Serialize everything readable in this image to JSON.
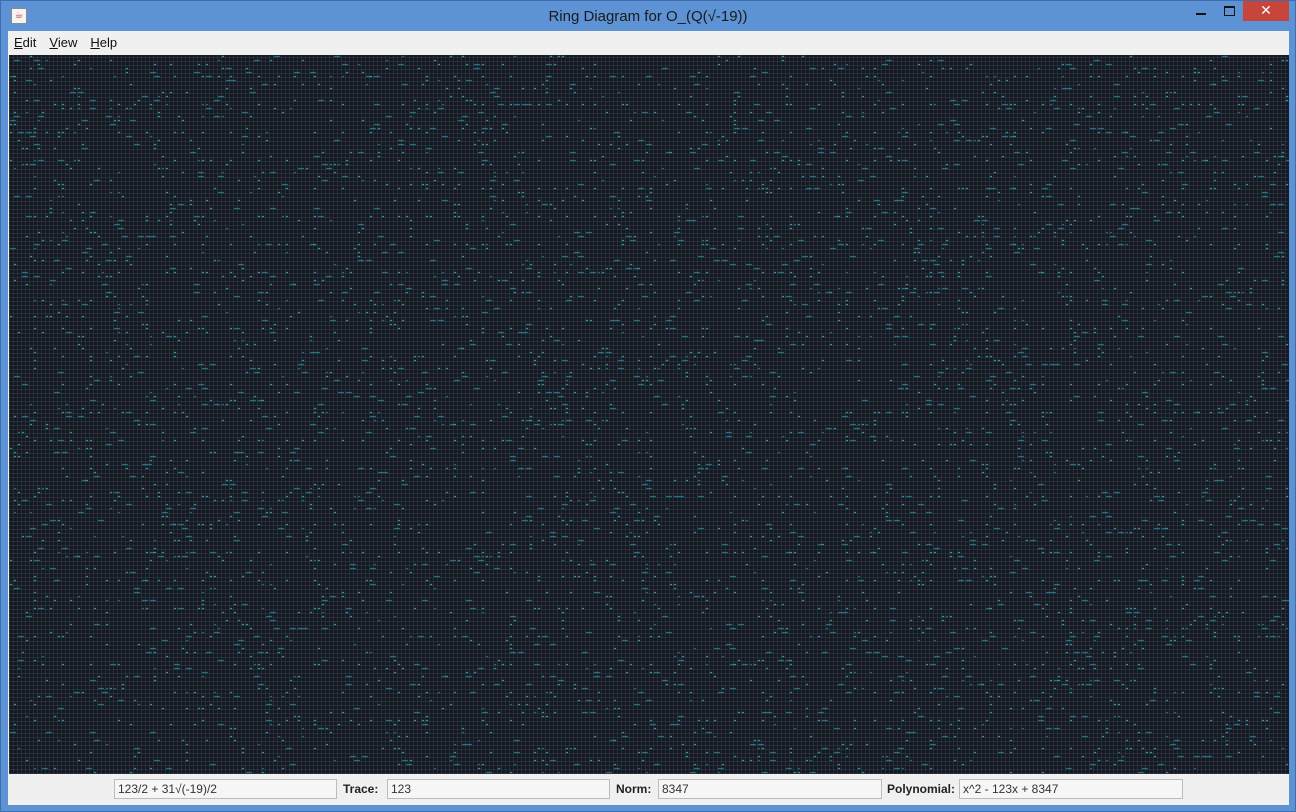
{
  "window": {
    "title": "Ring Diagram for O_(Q(√-19))",
    "controls": {
      "minimize_icon": "minimize-icon",
      "maximize_icon": "maximize-icon",
      "close_icon": "close-icon"
    }
  },
  "menu": {
    "items": [
      {
        "mnemonic": "E",
        "rest": "dit"
      },
      {
        "mnemonic": "V",
        "rest": "iew"
      },
      {
        "mnemonic": "H",
        "rest": "elp"
      }
    ]
  },
  "diagram": {
    "background": "#141820",
    "grid_color": "#3c4650",
    "dot_color": "#3fd0d8",
    "dot_color_dim": "#2a8fa6"
  },
  "status": {
    "element": "123/2 + 31√(-19)/2",
    "trace_label": "Trace:",
    "trace_value": "123",
    "norm_label": "Norm:",
    "norm_value": "8347",
    "polynomial_label": "Polynomial:",
    "polynomial_value": "x^2 - 123x + 8347"
  }
}
